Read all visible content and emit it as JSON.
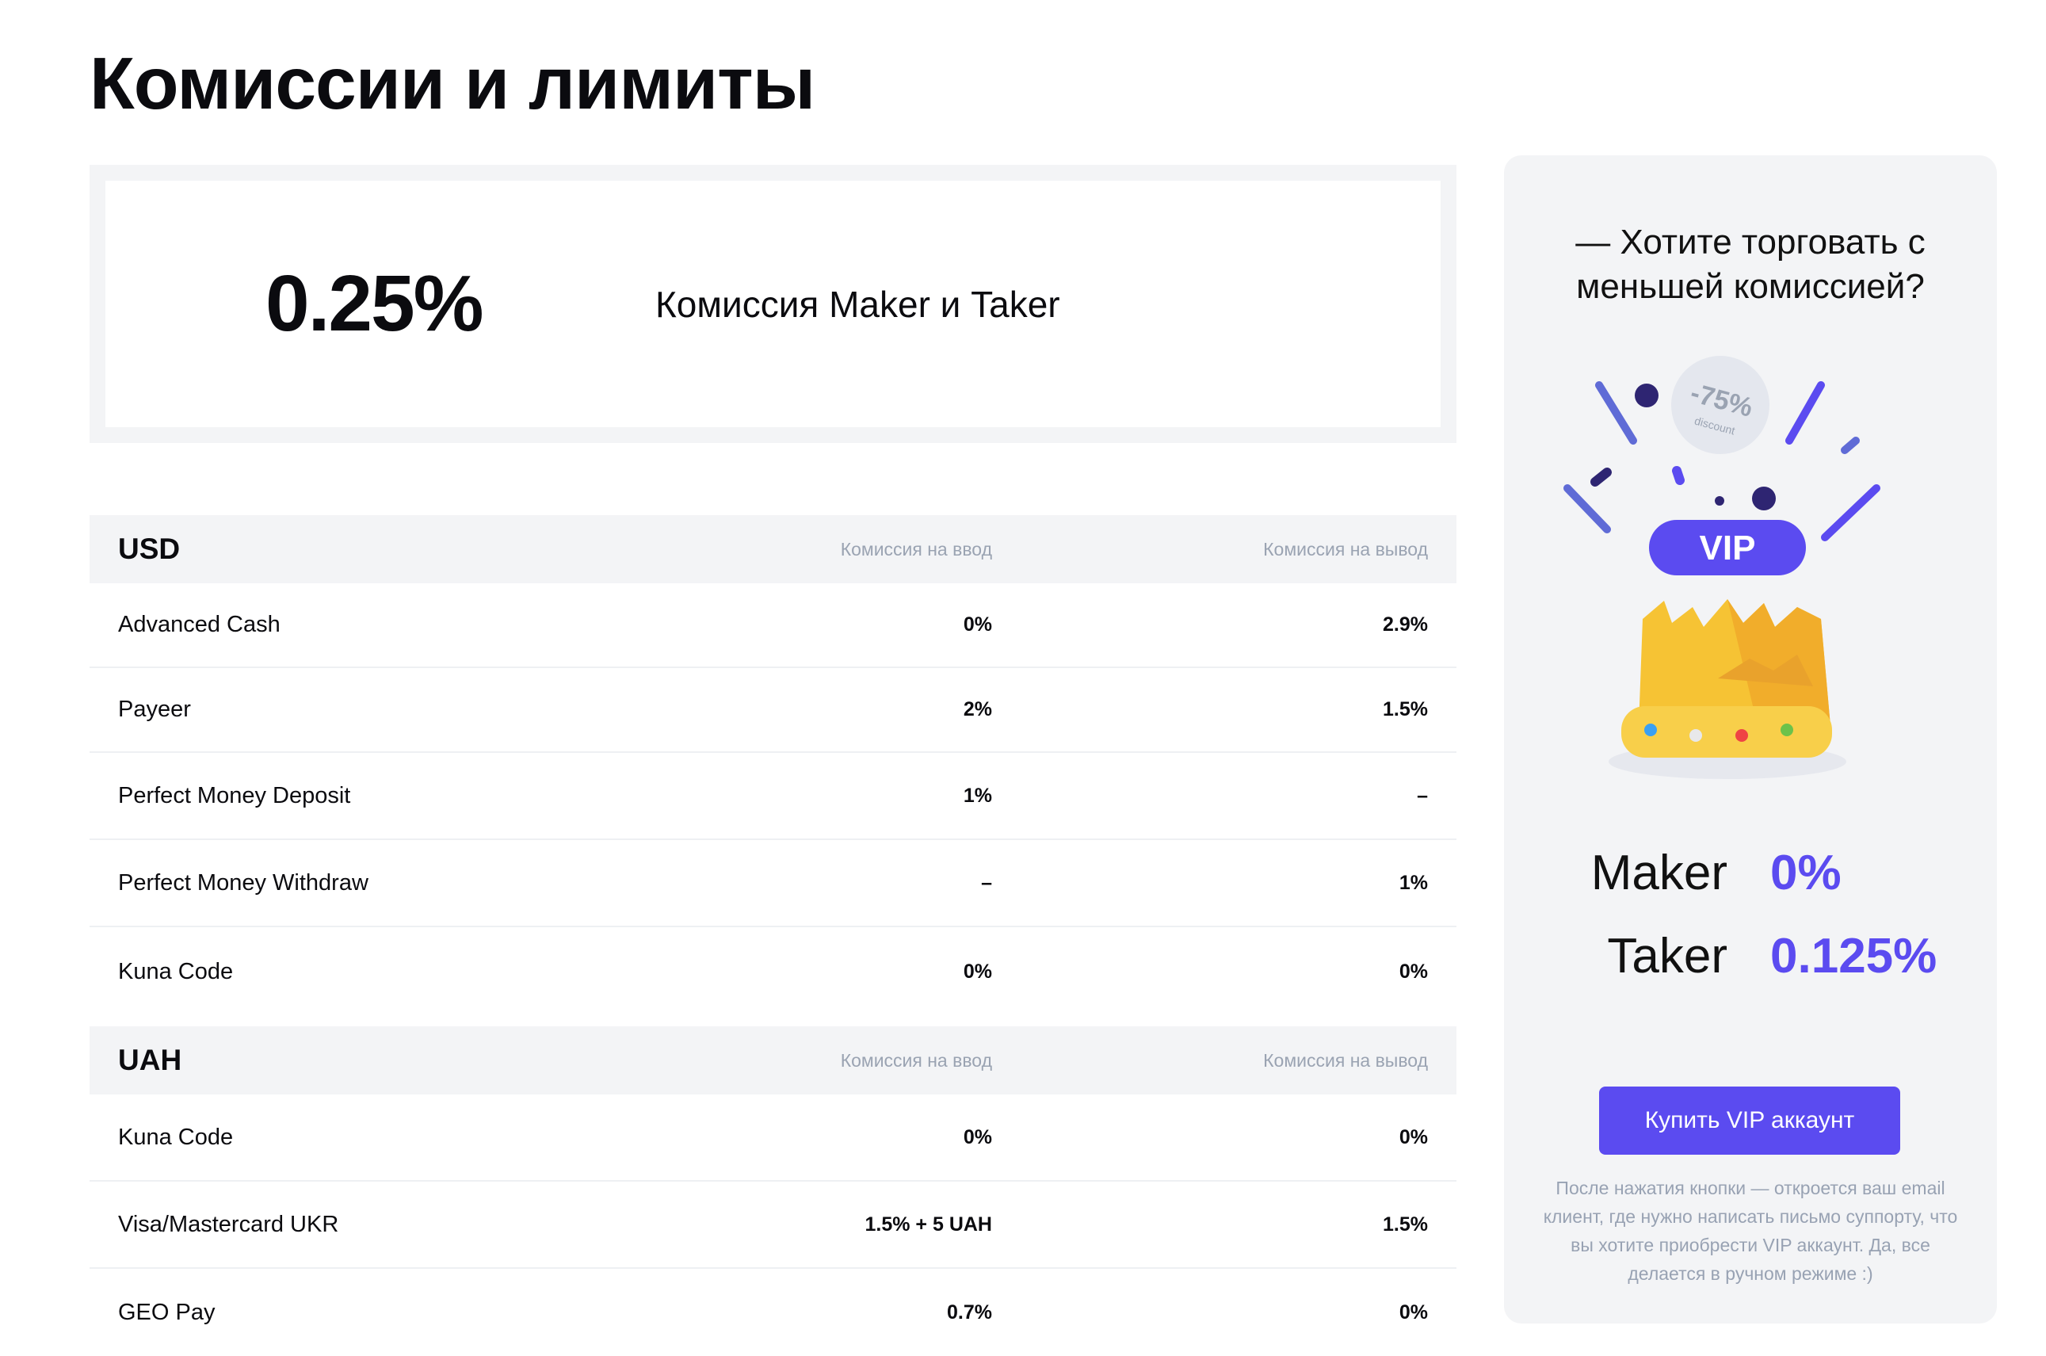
{
  "page": {
    "title": "Комиссии и лимиты"
  },
  "trading_fee": {
    "value": "0.25%",
    "label": "Комиссия Maker и Taker"
  },
  "tables": [
    {
      "currency": "USD",
      "col_in": "Комиссия на ввод",
      "col_out": "Комиссия на вывод",
      "rows": [
        {
          "name": "Advanced Cash",
          "in": "0%",
          "out": "2.9%"
        },
        {
          "name": "Payeer",
          "in": "2%",
          "out": "1.5%"
        },
        {
          "name": "Perfect Money Deposit",
          "in": "1%",
          "out": "–"
        },
        {
          "name": "Perfect Money Withdraw",
          "in": "–",
          "out": "1%"
        },
        {
          "name": "Kuna Code",
          "in": "0%",
          "out": "0%"
        }
      ]
    },
    {
      "currency": "UAH",
      "col_in": "Комиссия на ввод",
      "col_out": "Комиссия на вывод",
      "rows": [
        {
          "name": "Kuna Code",
          "in": "0%",
          "out": "0%"
        },
        {
          "name": "Visa/Mastercard UKR",
          "in": "1.5% + 5 UAH",
          "out": "1.5%"
        },
        {
          "name": "GEO Pay",
          "in": "0.7%",
          "out": "0%"
        }
      ]
    }
  ],
  "vip": {
    "question_line1": "— Хотите торговать с",
    "question_line2": "меньшей комиссией?",
    "badge_discount": "-75%",
    "badge_caption": "discount",
    "badge_label": "VIP",
    "maker_label": "Maker",
    "maker_value": "0%",
    "taker_label": "Taker",
    "taker_value": "0.125%",
    "button_label": "Купить VIP аккаунт",
    "note": "После нажатия кнопки — откроется ваш email клиент, где нужно написать письмо суппорту, что вы хотите приобрести VIP аккаунт. Да, все делается в ручном режиме :)",
    "accent_color": "#5b4bf0"
  }
}
